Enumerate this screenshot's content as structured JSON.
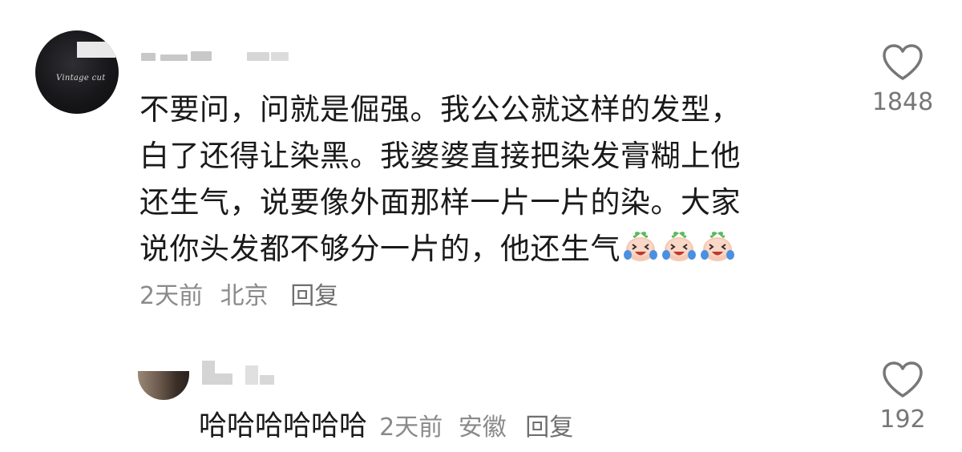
{
  "main_comment": {
    "avatar_caption": "Vintage cut",
    "text_lines": [
      "不要问，问就是倔强。我公公就这样的发型，",
      "白了还得让染黑。我婆婆直接把染发膏糊上他",
      "还生气，说要像外面那样一片一片的染。大家",
      "说你头发都不够分一片的，他还生气"
    ],
    "emoji_count": 3,
    "emoji_name": "crying-laughing-peach",
    "time": "2天前",
    "location": "北京",
    "reply_label": "回复",
    "like_count": "1848"
  },
  "reply_comment": {
    "text": "哈哈哈哈哈哈",
    "time": "2天前",
    "location": "安徽",
    "reply_label": "回复",
    "like_count": "192"
  },
  "colors": {
    "text": "#1a1a1a",
    "meta": "#8a8a8a",
    "icon": "#777777"
  }
}
